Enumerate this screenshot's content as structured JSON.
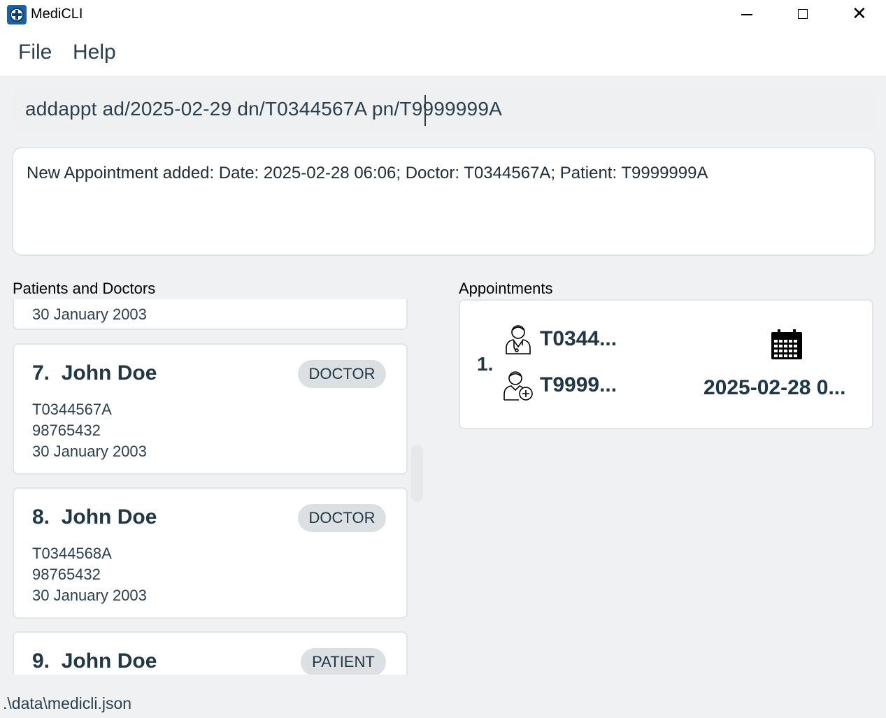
{
  "window": {
    "title": "MediCLI"
  },
  "menu": {
    "file_label": "File",
    "help_label": "Help"
  },
  "command": {
    "value": "addappt ad/2025-02-29 dn/T0344567A pn/T9999999A"
  },
  "result": {
    "message": "New Appointment added: Date: 2025-02-28 06:06; Doctor: T0344567A; Patient: T9999999A"
  },
  "persons_panel": {
    "title": "Patients and Doctors",
    "partial_card_dob": "30 January 2003",
    "cards": [
      {
        "index": "7.",
        "name": "John Doe",
        "role": "DOCTOR",
        "nric": "T0344567A",
        "phone": "98765432",
        "dob": "30 January 2003"
      },
      {
        "index": "8.",
        "name": "John Doe",
        "role": "DOCTOR",
        "nric": "T0344568A",
        "phone": "98765432",
        "dob": "30 January 2003"
      },
      {
        "index": "9.",
        "name": "John Doe",
        "role": "PATIENT",
        "nric": "",
        "phone": "",
        "dob": ""
      }
    ]
  },
  "appointments_panel": {
    "title": "Appointments",
    "items": [
      {
        "index": "1.",
        "doctor": "T0344...",
        "patient": "T9999...",
        "datetime": "2025-02-28 0..."
      }
    ]
  },
  "status": {
    "path": ".\\data\\medicli.json"
  },
  "icons": {
    "app": "medicli-logo-icon",
    "doctor": "doctor-icon",
    "patient": "patient-icon",
    "calendar": "calendar-icon"
  }
}
